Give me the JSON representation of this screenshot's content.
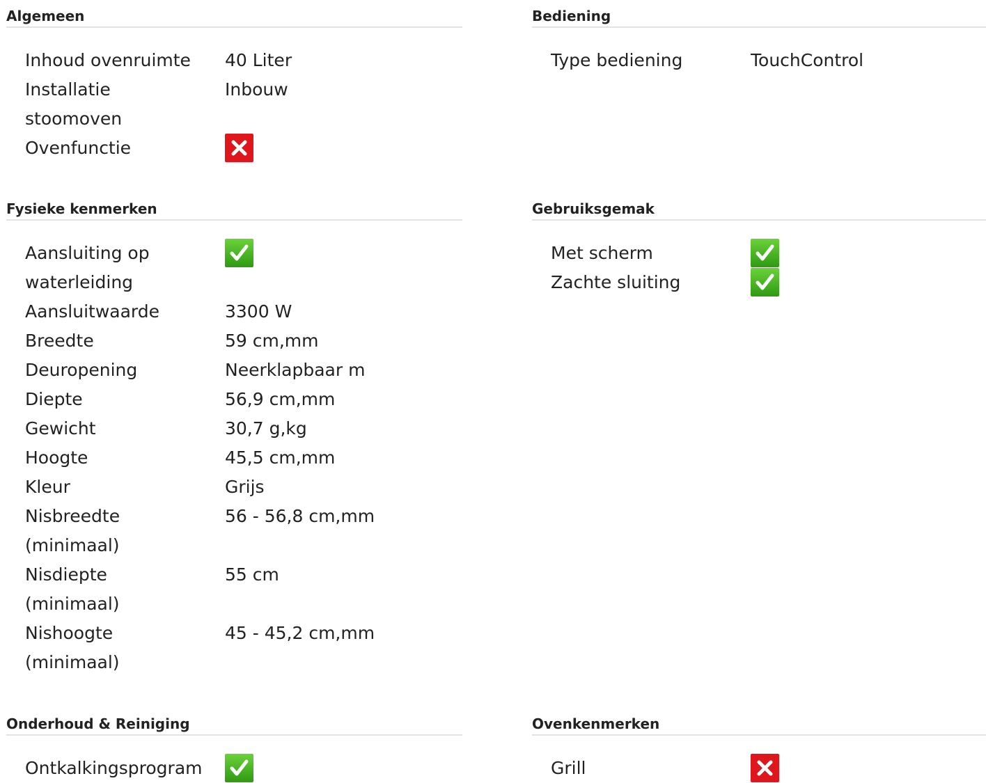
{
  "colors": {
    "cross": "#e0161d",
    "check": "#3fae1e",
    "divider": "#e3e3e3"
  },
  "sections": [
    {
      "title": "Algemeen",
      "rows": [
        {
          "label": "Inhoud ovenruimte",
          "value": "40 Liter"
        },
        {
          "label": "Installatie stoomoven",
          "value": "Inbouw"
        },
        {
          "label": "Ovenfunctie",
          "icon": "cross-icon"
        }
      ]
    },
    {
      "title": "Bediening",
      "rows": [
        {
          "label": "Type bediening",
          "value": "TouchControl"
        }
      ]
    },
    {
      "title": "Fysieke kenmerken",
      "rows": [
        {
          "label": "Aansluiting op waterleiding",
          "icon": "check-icon"
        },
        {
          "label": "Aansluitwaarde",
          "value": "3300 W"
        },
        {
          "label": "Breedte",
          "value": "59 cm,mm"
        },
        {
          "label": "Deuropening",
          "value": "Neerklapbaar m"
        },
        {
          "label": "Diepte",
          "value": "56,9 cm,mm"
        },
        {
          "label": "Gewicht",
          "value": "30,7 g,kg"
        },
        {
          "label": "Hoogte",
          "value": "45,5 cm,mm"
        },
        {
          "label": "Kleur",
          "value": "Grijs"
        },
        {
          "label": "Nisbreedte (minimaal)",
          "value": "56 - 56,8 cm,mm"
        },
        {
          "label": "Nisdiepte (minimaal)",
          "value": "55 cm"
        },
        {
          "label": "Nishoogte (minimaal)",
          "value": "45 - 45,2 cm,mm"
        }
      ]
    },
    {
      "title": "Gebruiksgemak",
      "rows": [
        {
          "label": "Met scherm",
          "icon": "check-icon"
        },
        {
          "label": "Zachte sluiting",
          "icon": "check-icon"
        }
      ]
    },
    {
      "title": "Onderhoud & Reiniging",
      "rows": [
        {
          "label": "Ontkalkingsprogram",
          "icon": "check-icon"
        }
      ]
    },
    {
      "title": "Ovenkenmerken",
      "rows": [
        {
          "label": "Grill",
          "icon": "cross-icon"
        }
      ]
    }
  ]
}
